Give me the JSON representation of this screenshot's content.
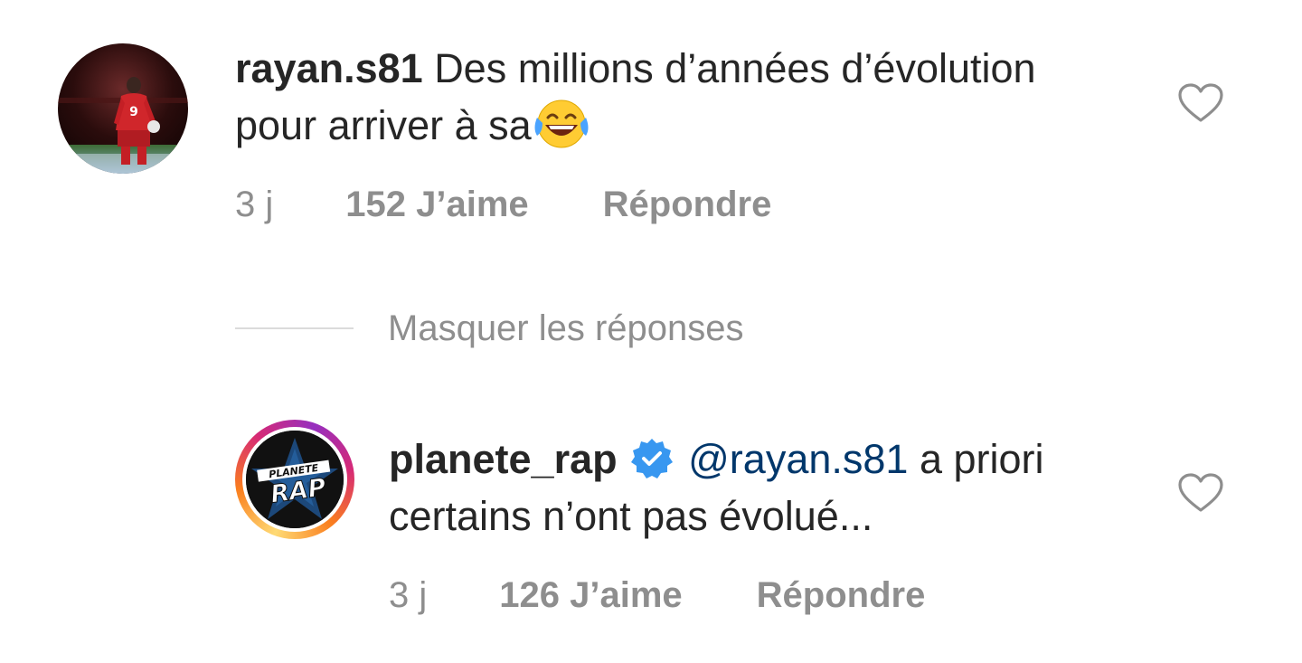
{
  "comments": [
    {
      "username": "rayan.s81",
      "text": "Des millions d’années d’évolution pour arriver à sa",
      "emoji": "face-with-tears-of-joy",
      "time": "3 j",
      "likes": "152 J’aime",
      "reply": "Répondre",
      "avatar": "footballer-red-jersey-9-photo"
    },
    {
      "username": "planete_rap",
      "verified": true,
      "mention": "@rayan.s81",
      "text": "a priori certains n’ont pas évolué...",
      "time": "3 j",
      "likes": "126 J’aime",
      "reply": "Répondre",
      "avatar": "planete-rap-logo",
      "avatar_logo_text": [
        "PLANETE",
        "RAP"
      ],
      "has_story_ring": true
    }
  ],
  "hide_replies_label": "Masquer les réponses",
  "icons": {
    "like": "heart-outline-icon",
    "verified": "verified-badge-icon"
  },
  "colors": {
    "text": "#262626",
    "meta": "#8e8e8e",
    "mention": "#00376b",
    "verified": "#3897f0",
    "divider": "#dbdbdb"
  }
}
